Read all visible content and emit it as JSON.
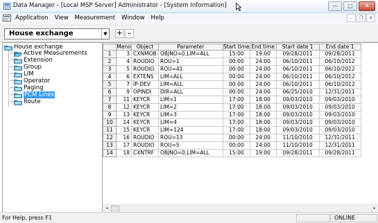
{
  "window": {
    "title": "Data Manager - [Local MSP Server] Administrator - [System Information]",
    "minimize": "—",
    "maximize": "▢",
    "close": "✕"
  },
  "menubar": {
    "items": [
      "Application",
      "View",
      "Measurement",
      "Window",
      "Help"
    ],
    "mdi_minimize": "–",
    "mdi_restore": "❐",
    "mdi_close": "✕"
  },
  "toolbar": {
    "combo_value": "House exchange",
    "combo_arrow": "▼",
    "add_label": "+",
    "remove_label": "–"
  },
  "tree": {
    "root": "House exchange",
    "items": [
      {
        "label": "Active Measurements",
        "icon": "folder-open-icon"
      },
      {
        "label": "Extension",
        "icon": "folder-icon"
      },
      {
        "label": "Group",
        "icon": "folder-icon"
      },
      {
        "label": "LIM",
        "icon": "folder-icon"
      },
      {
        "label": "Operator",
        "icon": "folder-icon"
      },
      {
        "label": "Paging",
        "icon": "folder-icon"
      },
      {
        "label": "PCM Lines",
        "icon": "folder-icon",
        "selected": true
      },
      {
        "label": "Route",
        "icon": "folder-icon"
      }
    ]
  },
  "grid": {
    "columns": [
      "",
      "Meno",
      "Object",
      "Parameter",
      "Start time",
      "End time",
      "Start date 1",
      "End date 1"
    ],
    "rows": [
      [
        "1",
        "3",
        "CXNMOB",
        "OBJNO=0,LIM=ALL",
        "15:00",
        "19:00",
        "09/28/2011",
        "09/28/2011"
      ],
      [
        "2",
        "4",
        "ROUDIO",
        "ROU=1",
        "00:00",
        "24:00",
        "06/10/2011",
        "06/10/2012"
      ],
      [
        "3",
        "5",
        "ROUDIO",
        "ROU=41",
        "00:00",
        "24:00",
        "06/10/2011",
        "06/10/2012"
      ],
      [
        "4",
        "6",
        "EXTENS",
        "LIM=ALL",
        "00:00",
        "24:00",
        "06/10/2011",
        "06/10/2012"
      ],
      [
        "5",
        "7",
        "IP-DEV",
        "LIM=ALL",
        "00:00",
        "24:00",
        "06/10/2011",
        "06/10/2012"
      ],
      [
        "6",
        "9",
        "OPINDI",
        "DIR=ALL",
        "00:00",
        "24:00",
        "06/25/2010",
        "12/31/2011"
      ],
      [
        "7",
        "11",
        "KEYCR",
        "LIM=1",
        "17:00",
        "18:00",
        "09/03/2010",
        "09/03/2010"
      ],
      [
        "8",
        "12",
        "KEYCR",
        "LIM=2",
        "17:00",
        "18:00",
        "09/03/2010",
        "09/03/2010"
      ],
      [
        "9",
        "13",
        "KEYCR",
        "LIM=3",
        "17:00",
        "18:00",
        "09/03/2010",
        "09/03/2010"
      ],
      [
        "10",
        "14",
        "KEYCR",
        "LIM=4",
        "17:00",
        "18:00",
        "09/03/2010",
        "09/03/2010"
      ],
      [
        "11",
        "15",
        "KEYCR",
        "LIM=124",
        "17:00",
        "18:00",
        "09/03/2010",
        "09/03/2010"
      ],
      [
        "12",
        "16",
        "ROUDIO",
        "ROU=13",
        "00:00",
        "24:00",
        "11/10/2010",
        "12/31/2011"
      ],
      [
        "13",
        "17",
        "ROUDIO",
        "ROU=5",
        "00:00",
        "24:00",
        "11/10/2010",
        "12/31/2011"
      ],
      [
        "14",
        "18",
        "CXNTRF",
        "OBJNO=0,LIM=ALL",
        "15:00",
        "19:00",
        "09/28/2011",
        "09/28/2011"
      ]
    ]
  },
  "scroll": {
    "left_arrow": "◂",
    "right_arrow": "▸"
  },
  "status": {
    "help": "For Help, press F1",
    "connection": "ONLINE"
  }
}
